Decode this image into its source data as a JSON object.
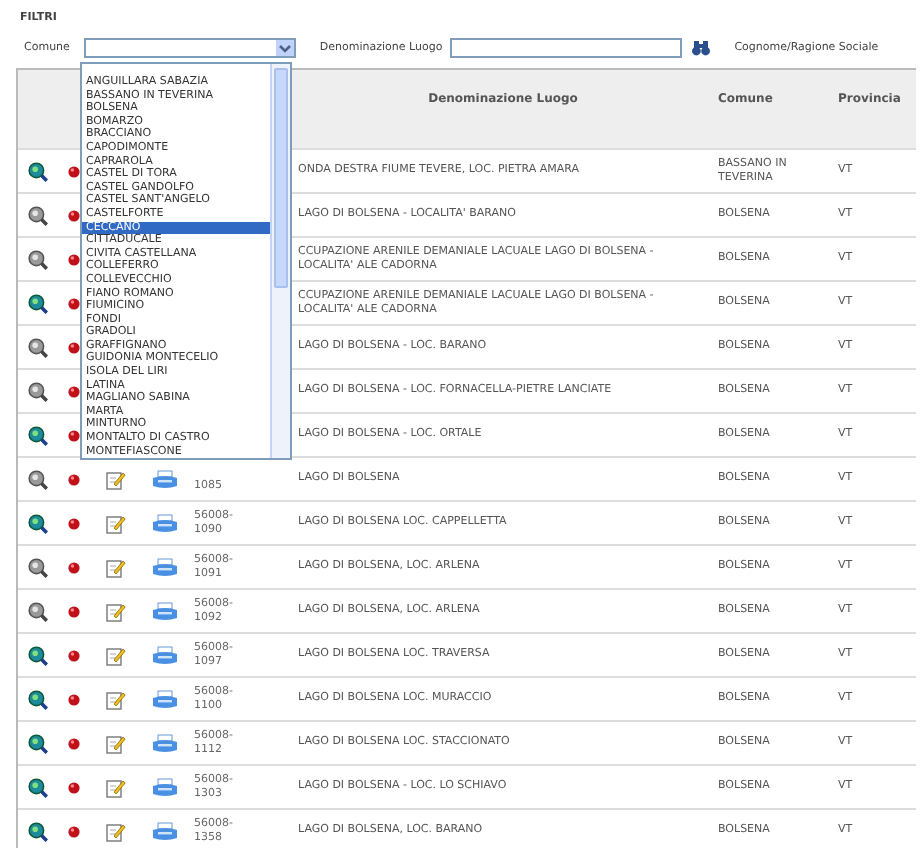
{
  "title": "FILTRI",
  "filters": {
    "comune": {
      "label": "Comune",
      "expanded": true,
      "options": [
        {
          "label": "ANGUILLARA SABAZIA",
          "selected": false
        },
        {
          "label": "BASSANO IN TEVERINA",
          "selected": false
        },
        {
          "label": "BOLSENA",
          "selected": false
        },
        {
          "label": "BOMARZO",
          "selected": false
        },
        {
          "label": "BRACCIANO",
          "selected": false
        },
        {
          "label": "CAPODIMONTE",
          "selected": false
        },
        {
          "label": "CAPRAROLA",
          "selected": false
        },
        {
          "label": "CASTEL DI TORA",
          "selected": false
        },
        {
          "label": "CASTEL GANDOLFO",
          "selected": false
        },
        {
          "label": "CASTEL SANT'ANGELO",
          "selected": false
        },
        {
          "label": "CASTELFORTE",
          "selected": false
        },
        {
          "label": "CECCANO",
          "selected": true
        },
        {
          "label": "CITTADUCALE",
          "selected": false
        },
        {
          "label": "CIVITA CASTELLANA",
          "selected": false
        },
        {
          "label": "COLLEFERRO",
          "selected": false
        },
        {
          "label": "COLLEVECCHIO",
          "selected": false
        },
        {
          "label": "FIANO ROMANO",
          "selected": false
        },
        {
          "label": "FIUMICINO",
          "selected": false
        },
        {
          "label": "FONDI",
          "selected": false
        },
        {
          "label": "GRADOLI",
          "selected": false
        },
        {
          "label": "GRAFFIGNANO",
          "selected": false
        },
        {
          "label": "GUIDONIA MONTECELIO",
          "selected": false
        },
        {
          "label": "ISOLA DEL LIRI",
          "selected": false
        },
        {
          "label": "LATINA",
          "selected": false
        },
        {
          "label": "MAGLIANO SABINA",
          "selected": false
        },
        {
          "label": "MARTA",
          "selected": false
        },
        {
          "label": "MINTURNO",
          "selected": false
        },
        {
          "label": "MONTALTO DI CASTRO",
          "selected": false
        },
        {
          "label": "MONTEFIASCONE",
          "selected": false
        }
      ]
    },
    "denominazione": {
      "label": "Denominazione Luogo"
    },
    "cognome": {
      "label": "Cognome/Ragione Sociale"
    }
  },
  "table": {
    "columns": [
      "Denominazione Luogo",
      "Comune",
      "Provincia"
    ],
    "rows": [
      {
        "active": true,
        "denominazione": "ONDA DESTRA FIUME TEVERE, LOC. PIETRA AMARA",
        "comune": "BASSANO IN TEVERINA",
        "provincia": "VT"
      },
      {
        "active": false,
        "denominazione": "LAGO DI BOLSENA - LOCALITA' BARANO",
        "comune": "BOLSENA",
        "provincia": "VT"
      },
      {
        "active": false,
        "denominazione": "CCUPAZIONE ARENILE DEMANIALE LACUALE LAGO DI BOLSENA - LOCALITA' ALE CADORNA",
        "comune": "BOLSENA",
        "provincia": "VT"
      },
      {
        "active": true,
        "denominazione": "CCUPAZIONE ARENILE DEMANIALE LACUALE LAGO DI BOLSENA - LOCALITA' ALE CADORNA",
        "comune": "BOLSENA",
        "provincia": "VT"
      },
      {
        "active": false,
        "denominazione": "LAGO DI BOLSENA - LOC. BARANO",
        "comune": "BOLSENA",
        "provincia": "VT"
      },
      {
        "active": false,
        "denominazione": "LAGO DI BOLSENA - LOC. FORNACELLA-PIETRE LANCIATE",
        "comune": "BOLSENA",
        "provincia": "VT"
      },
      {
        "active": true,
        "denominazione": "LAGO DI BOLSENA - LOC. ORTALE",
        "comune": "BOLSENA",
        "provincia": "VT"
      },
      {
        "active": false,
        "code": [
          "1085"
        ],
        "denominazione": "LAGO DI BOLSENA",
        "comune": "BOLSENA",
        "provincia": "VT"
      },
      {
        "active": true,
        "code": [
          "56008-",
          "1090"
        ],
        "denominazione": "LAGO DI BOLSENA LOC. CAPPELLETTA",
        "comune": "BOLSENA",
        "provincia": "VT"
      },
      {
        "active": false,
        "code": [
          "56008-",
          "1091"
        ],
        "denominazione": "LAGO DI BOLSENA, LOC. ARLENA",
        "comune": "BOLSENA",
        "provincia": "VT"
      },
      {
        "active": false,
        "code": [
          "56008-",
          "1092"
        ],
        "denominazione": "LAGO DI BOLSENA, LOC. ARLENA",
        "comune": "BOLSENA",
        "provincia": "VT"
      },
      {
        "active": true,
        "code": [
          "56008-",
          "1097"
        ],
        "denominazione": "LAGO DI BOLSENA LOC. TRAVERSA",
        "comune": "BOLSENA",
        "provincia": "VT"
      },
      {
        "active": true,
        "code": [
          "56008-",
          "1100"
        ],
        "denominazione": "LAGO DI BOLSENA LOC. MURACCIO",
        "comune": "BOLSENA",
        "provincia": "VT"
      },
      {
        "active": true,
        "code": [
          "56008-",
          "1112"
        ],
        "denominazione": "LAGO DI BOLSENA LOC. STACCIONATO",
        "comune": "BOLSENA",
        "provincia": "VT"
      },
      {
        "active": true,
        "code": [
          "56008-",
          "1303"
        ],
        "denominazione": "LAGO DI BOLSENA - LOC. LO SCHIAVO",
        "comune": "BOLSENA",
        "provincia": "VT"
      },
      {
        "active": true,
        "code": [
          "56008-",
          "1358"
        ],
        "denominazione": "LAGO DI BOLSENA, LOC. BARANO",
        "comune": "BOLSENA",
        "provincia": "VT"
      }
    ]
  }
}
